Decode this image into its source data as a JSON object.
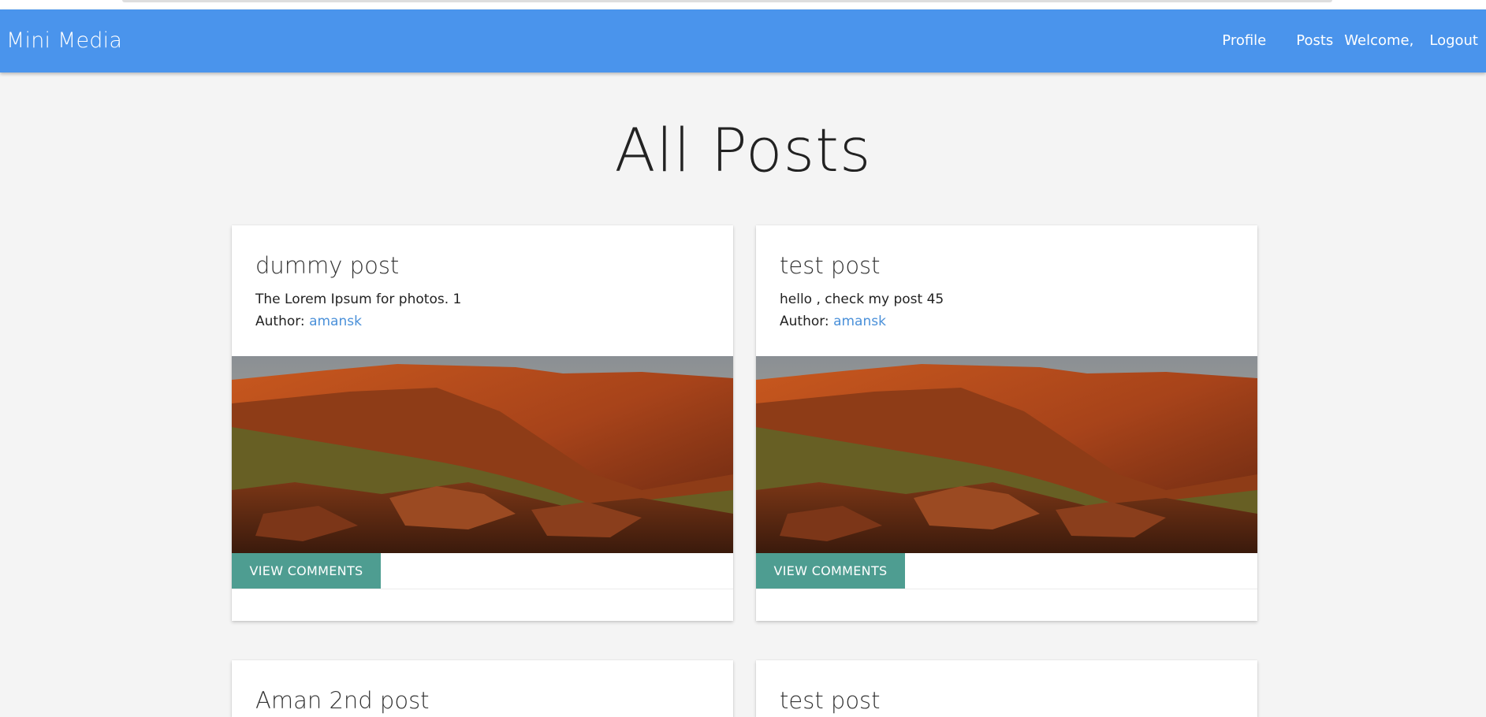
{
  "app": {
    "brand": "Mini Media"
  },
  "nav": {
    "profile": "Profile",
    "posts": "Posts",
    "welcome": "Welcome,",
    "logout": "Logout"
  },
  "page": {
    "title": "All Posts"
  },
  "posts": [
    {
      "title": "dummy post",
      "description": "The Lorem Ipsum for photos. 1",
      "author_label": "Author:",
      "author": "amansk",
      "button": "VIEW COMMENTS"
    },
    {
      "title": "test post",
      "description": "hello , check my post 45",
      "author_label": "Author:",
      "author": "amansk",
      "button": "VIEW COMMENTS"
    },
    {
      "title": "Aman 2nd post"
    },
    {
      "title": "test post"
    }
  ],
  "colors": {
    "navbar": "#4a94ec",
    "button": "#4e9d91",
    "link": "#4a90d9",
    "background": "#f4f4f4"
  }
}
